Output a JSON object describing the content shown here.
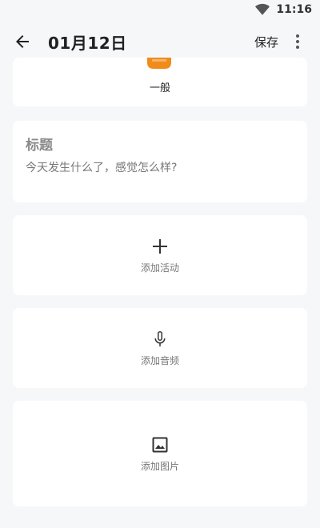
{
  "status": {
    "time": "11:16"
  },
  "header": {
    "title": "01月12日",
    "save_label": "保存"
  },
  "mood": {
    "label": "一般",
    "color": "#f08c1a"
  },
  "entry": {
    "title_placeholder": "标题",
    "body_placeholder": "今天发生什么了，感觉怎么样?"
  },
  "actions": {
    "activity_label": "添加活动",
    "audio_label": "添加音频",
    "image_label": "添加图片"
  },
  "icons": {
    "back": "arrow-left-icon",
    "more": "more-vert-icon",
    "wifi": "wifi-icon",
    "add": "plus-icon",
    "mic": "microphone-icon",
    "image": "image-icon"
  }
}
